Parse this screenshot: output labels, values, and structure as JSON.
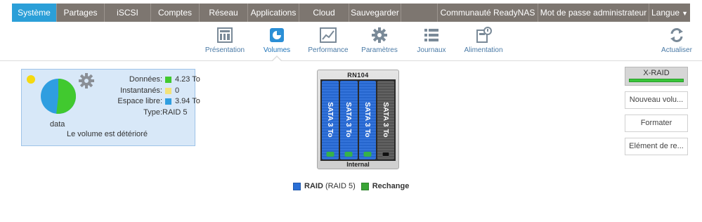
{
  "topnav": {
    "tabs": [
      {
        "label": "Système",
        "active": true
      },
      {
        "label": "Partages",
        "active": false
      },
      {
        "label": "iSCSI",
        "active": false
      },
      {
        "label": "Comptes",
        "active": false
      },
      {
        "label": "Réseau",
        "active": false
      },
      {
        "label": "Applications",
        "active": false
      },
      {
        "label": "Cloud",
        "active": false
      },
      {
        "label": "Sauvegarder",
        "active": false
      }
    ],
    "community": "Communauté ReadyNAS",
    "admin_password": "Mot de passe administrateur",
    "language": "Langue"
  },
  "subnav": {
    "items": [
      {
        "label": "Présentation",
        "icon": "overview-icon"
      },
      {
        "label": "Volumes",
        "icon": "volumes-icon",
        "active": true
      },
      {
        "label": "Performance",
        "icon": "performance-chart-icon"
      },
      {
        "label": "Paramètres",
        "icon": "gear-icon"
      },
      {
        "label": "Journaux",
        "icon": "list-icon"
      },
      {
        "label": "Alimentation",
        "icon": "power-icon"
      }
    ],
    "refresh": "Actualiser"
  },
  "volume": {
    "name": "data",
    "status": "Le volume est détérioré",
    "status_color": "#f5d90f",
    "data_label": "Données:",
    "data_value": "4.23 To",
    "data_color": "#41c92f",
    "snapshots_label": "Instantanés:",
    "snapshots_value": "0",
    "snapshots_color": "#f2e27a",
    "free_label": "Espace libre:",
    "free_value": "3.94 To",
    "free_color": "#2f9ee0",
    "type_label": "Type:",
    "type_value": "RAID 5",
    "used_fraction": 0.518
  },
  "chassis": {
    "model": "RN104",
    "location": "Internal",
    "disks": [
      {
        "label": "SATA 3 To",
        "role": "raid"
      },
      {
        "label": "SATA 3 To",
        "role": "raid"
      },
      {
        "label": "SATA 3 To",
        "role": "raid"
      },
      {
        "label": "SATA 3 To",
        "role": "spare"
      }
    ]
  },
  "legend": {
    "raid_label": "RAID",
    "raid_detail": "(RAID 5)",
    "raid_color": "#2a6fd6",
    "spare_label": "Rechange",
    "spare_color": "#3aa536"
  },
  "actions": {
    "xraid": "X-RAID",
    "new_volume": "Nouveau volu...",
    "format": "Formater",
    "element": "Elément de re..."
  }
}
